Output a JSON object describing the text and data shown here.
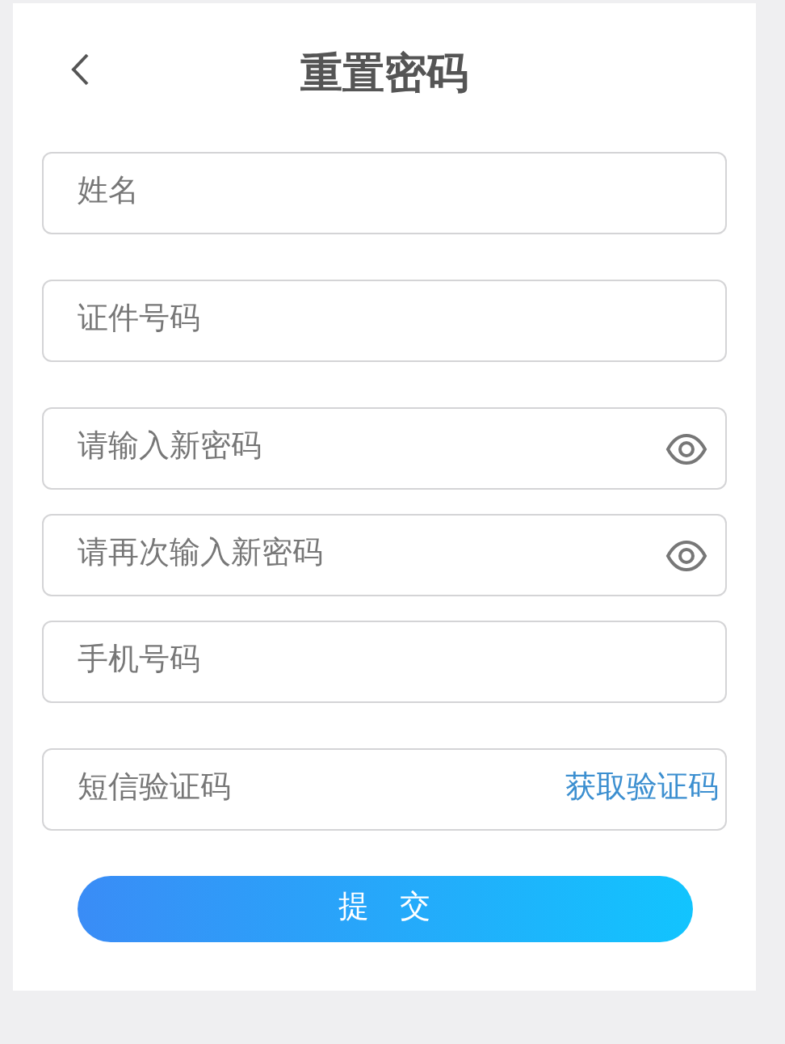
{
  "header": {
    "title": "重置密码"
  },
  "field_groups": [
    [
      {
        "kind": "text",
        "placeholder": "姓名"
      }
    ],
    [
      {
        "kind": "text",
        "placeholder": "证件号码"
      }
    ],
    [
      {
        "kind": "password",
        "placeholder": "请输入新密码"
      },
      {
        "kind": "password",
        "placeholder": "请再次输入新密码"
      },
      {
        "kind": "text",
        "placeholder": "手机号码"
      }
    ],
    [
      {
        "kind": "code",
        "placeholder": "短信验证码",
        "action": "获取验证码"
      }
    ]
  ],
  "submit": "提 交"
}
